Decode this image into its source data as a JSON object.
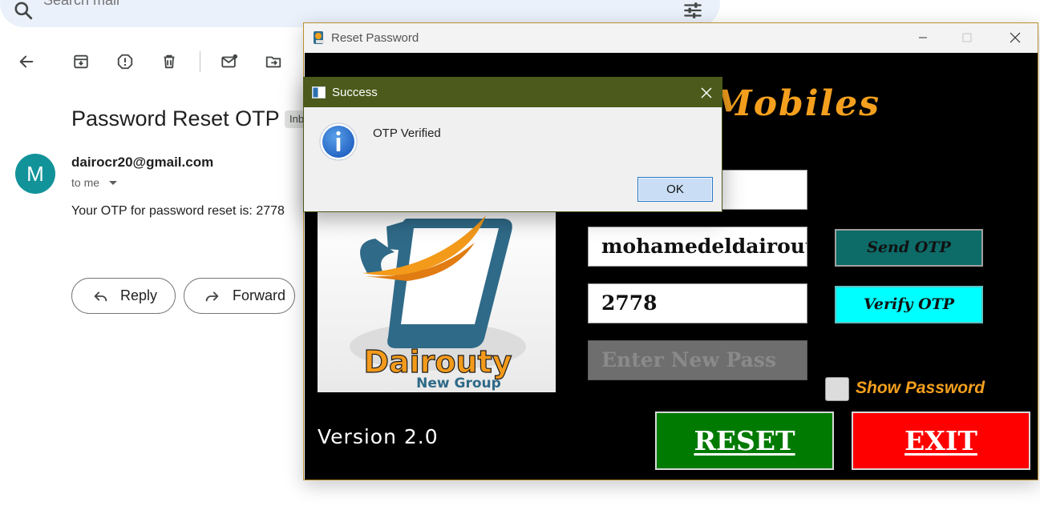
{
  "gmail": {
    "search": {
      "placeholder": "Search mail",
      "search_icon": "search-icon",
      "filter_icon": "tune-icon"
    },
    "toolbar_icons": [
      "back-arrow-icon",
      "archive-icon",
      "report-spam-icon",
      "delete-icon",
      "mark-unread-icon",
      "move-to-icon"
    ],
    "email": {
      "subject": "Password Reset OTP",
      "label": "Inbox",
      "avatar_letter": "M",
      "sender": "dairocr20@gmail.com",
      "to_line": "to me",
      "body": "Your OTP for password reset is: 2778"
    },
    "actions": {
      "reply": "Reply",
      "forward": "Forward"
    }
  },
  "reset_window": {
    "title": "Reset Password",
    "brand_text": "Mobiles",
    "logo": {
      "name": "Dairouty",
      "subtitle": "New Group"
    },
    "fields": {
      "email_value": "mohamedeldairouty",
      "otp_value": "2778",
      "new_pass_placeholder": "Enter New Pass"
    },
    "buttons": {
      "send_otp": "Send OTP",
      "verify_otp": "Verify OTP",
      "reset": "RESET",
      "exit": "EXIT"
    },
    "show_password_label": "Show Password",
    "show_password_checked": false,
    "version": "Version 2.0"
  },
  "dialog": {
    "title": "Success",
    "message": "OTP Verified",
    "ok_label": "OK",
    "icon": "info-icon"
  },
  "colors": {
    "accent_orange": "#f4a01e",
    "send_otp_bg": "#0d6b68",
    "verify_otp_bg": "#00ffff",
    "reset_bg": "#007a00",
    "exit_bg": "#ff0000",
    "dialog_titlebar": "#4c5a1b",
    "gmail_avatar": "#12939a"
  }
}
